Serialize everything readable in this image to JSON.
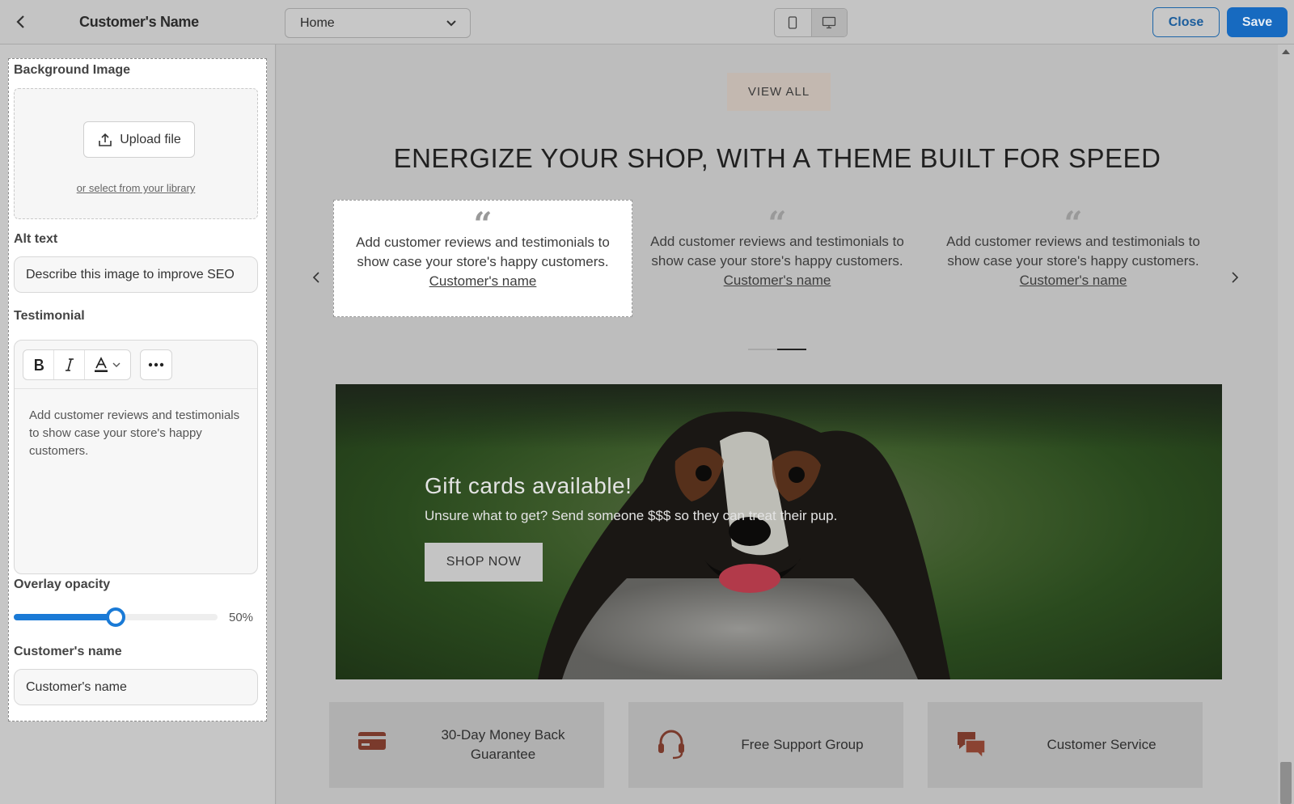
{
  "header": {
    "title": "Customer's Name",
    "page_select": "Home",
    "close_label": "Close",
    "save_label": "Save"
  },
  "settings": {
    "background_image": {
      "label": "Background Image",
      "upload_label": "Upload file",
      "library_link": "or select from your library"
    },
    "alt_text": {
      "label": "Alt text",
      "placeholder": "Describe this image to improve SEO"
    },
    "testimonial": {
      "label": "Testimonial",
      "text": "Add customer reviews and testimonials to show case your store's happy customers."
    },
    "overlay_opacity": {
      "label": "Overlay opacity",
      "value": 50,
      "value_label": "50%"
    },
    "customer_name": {
      "label": "Customer's name",
      "value": "Customer's name"
    }
  },
  "preview": {
    "view_all_label": "VIEW ALL",
    "headline": "ENERGIZE YOUR SHOP, WITH A THEME BUILT FOR SPEED",
    "testimonials": [
      {
        "quote": "“",
        "text": "Add customer reviews and testimonials to show case your store's happy customers.",
        "name": "Customer's name"
      },
      {
        "quote": "“",
        "text": "Add customer reviews and testimonials to show case your store's happy customers.",
        "name": "Customer's name"
      },
      {
        "quote": "“",
        "text": "Add customer reviews and testimonials to show case your store's happy customers.",
        "name": "Customer's name"
      }
    ],
    "banner": {
      "title": "Gift cards available!",
      "subtitle": "Unsure what to get? Send someone $$$ so they can treat their pup.",
      "button_label": "SHOP NOW"
    },
    "features": [
      {
        "icon": "credit-card-icon",
        "label": "30-Day Money Back Guarantee"
      },
      {
        "icon": "headset-icon",
        "label": "Free Support Group"
      },
      {
        "icon": "chat-bubbles-icon",
        "label": "Customer Service"
      }
    ]
  },
  "colors": {
    "accent": "#176ac0",
    "feature_icon": "#7a3a2c",
    "slider": "#1a7ad6"
  }
}
